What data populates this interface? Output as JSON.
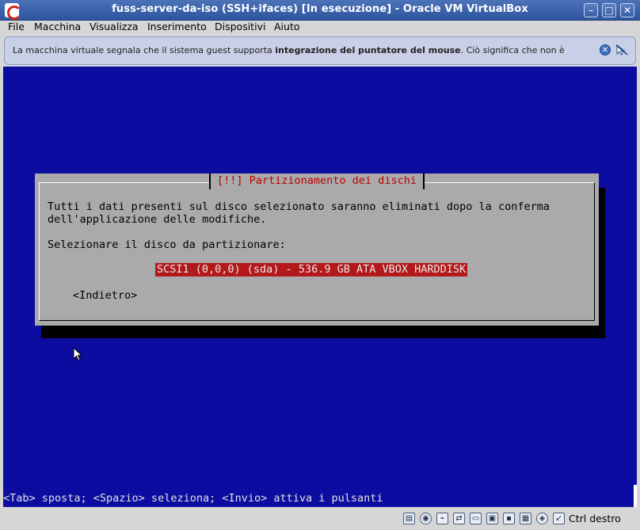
{
  "window": {
    "title": "fuss-server-da-iso (SSH+ifaces) [In esecuzione] - Oracle VM VirtualBox",
    "min_glyph": "–",
    "max_glyph": "□",
    "close_glyph": "✕"
  },
  "menubar": {
    "items": [
      "File",
      "Macchina",
      "Visualizza",
      "Inserimento",
      "Dispositivi",
      "Aiuto"
    ]
  },
  "banner": {
    "text_before": "La macchina virtuale segnala che il sistema guest supporta ",
    "text_bold": "integrazione del puntatore del mouse",
    "text_after": ". Ciò significa che non è",
    "close_glyph": "✕"
  },
  "dialog": {
    "title": "[!!] Partizionamento dei dischi",
    "line1": "Tutti i dati presenti sul disco selezionato saranno eliminati dopo la conferma",
    "line2": "dell'applicazione delle modifiche.",
    "prompt": "Selezionare il disco da partizionare:",
    "disk_option": "SCSI1 (0,0,0) (sda) - 536.9 GB ATA VBOX HARDDISK",
    "back_button": "<Indietro>"
  },
  "screen": {
    "status_line": "<Tab> sposta; <Spazio> seleziona; <Invio> attiva i pulsanti"
  },
  "statusbar": {
    "host_key": "Ctrl destro",
    "icons": [
      "hard-disk-icon",
      "optical-drive-icon",
      "usb-icon",
      "network-icon",
      "shared-folder-icon",
      "display-icon",
      "video-capture-icon",
      "cpu-icon",
      "mouse-integration-icon",
      "keyboard-capture-icon"
    ]
  }
}
